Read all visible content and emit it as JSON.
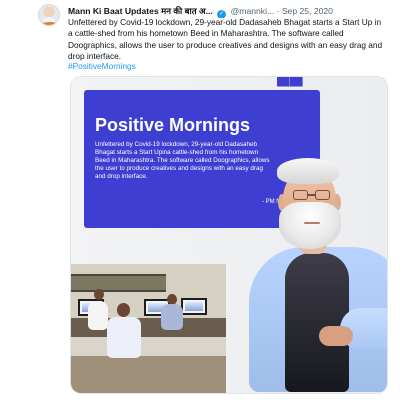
{
  "tweet": {
    "author_name": "Mann Ki Baat Updates मन की बात अ...",
    "handle": "@mannki...",
    "separator": "·",
    "date": "Sep 25, 2020",
    "body": "Unfettered by  Covid-19 lockdown,  29-year-old Dadasaheb Bhagat starts a Start Up in a cattle-shed  from his hometown Beed in Maharashtra. The software called Doographics, allows the user to produce creatives and designs with an easy drag and drop interface.",
    "hashtag": "#PositiveMornings"
  },
  "media": {
    "card_title": "Positive Mornings",
    "card_text": "Unfettered by Covid-19 lockdown, 29-year-old Dadasaheb Bhagat starts a Start Upina cattle-shed from his hometown Beed in Maharashtra. The software called Doographics, allows the user to produce creatives and designs with an easy drag and drop interface.",
    "card_author": "- PM Narendra Modi",
    "quote_open": "❝",
    "quote_close": "❞"
  },
  "icons": {
    "verified": "verified-icon"
  },
  "colors": {
    "accent": "#1d9bf0",
    "card_purple": "#3e3fd2",
    "text": "#0f1419",
    "muted": "#536471"
  }
}
